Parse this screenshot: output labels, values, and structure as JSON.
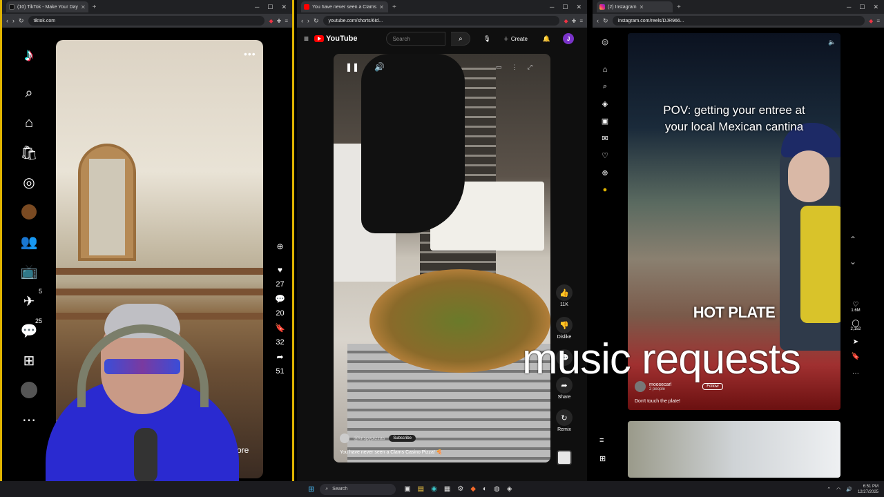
{
  "tiktok": {
    "tab_title": "(10) TikTok - Make Your Day",
    "url": "tiktok.com",
    "nav_badges": {
      "inbox": "5",
      "messages": "25"
    },
    "rail": {
      "likes": "27",
      "comments": "20",
      "saves": "32",
      "shares": "51"
    },
    "more_label": "more",
    "friends_label": "riends"
  },
  "youtube": {
    "tab_title": "You have never seen a Clams",
    "url": "youtube.com/shorts/6Id...",
    "logo": "YouTube",
    "search_placeholder": "Search",
    "create_label": "Create",
    "avatar_letter": "J",
    "rail": {
      "likes": "11K",
      "dislike": "Dislike",
      "share": "Share",
      "remix": "Remix"
    },
    "channel": "@krispypizzas",
    "subscribe": "Subscribe",
    "video_title": "You have never seen a Clams Casino Pizza! 🍕"
  },
  "instagram": {
    "tab_title": "(2) Instagram",
    "url": "instagram.com/reels/DJR966...",
    "caption_line1": "POV: getting your entree at",
    "caption_line2": "your local Mexican cantina",
    "hot_plate": "HOT PLATE",
    "username": "moosecarl",
    "people": "2 people",
    "follow": "Follow",
    "post_caption": "Don't touch the plate!",
    "rail": {
      "likes": "1.6M",
      "comments": "2,152"
    }
  },
  "overlay_text": "music requests",
  "taskbar": {
    "search": "Search",
    "time": "6:51 PM",
    "date": "12/27/2025"
  }
}
